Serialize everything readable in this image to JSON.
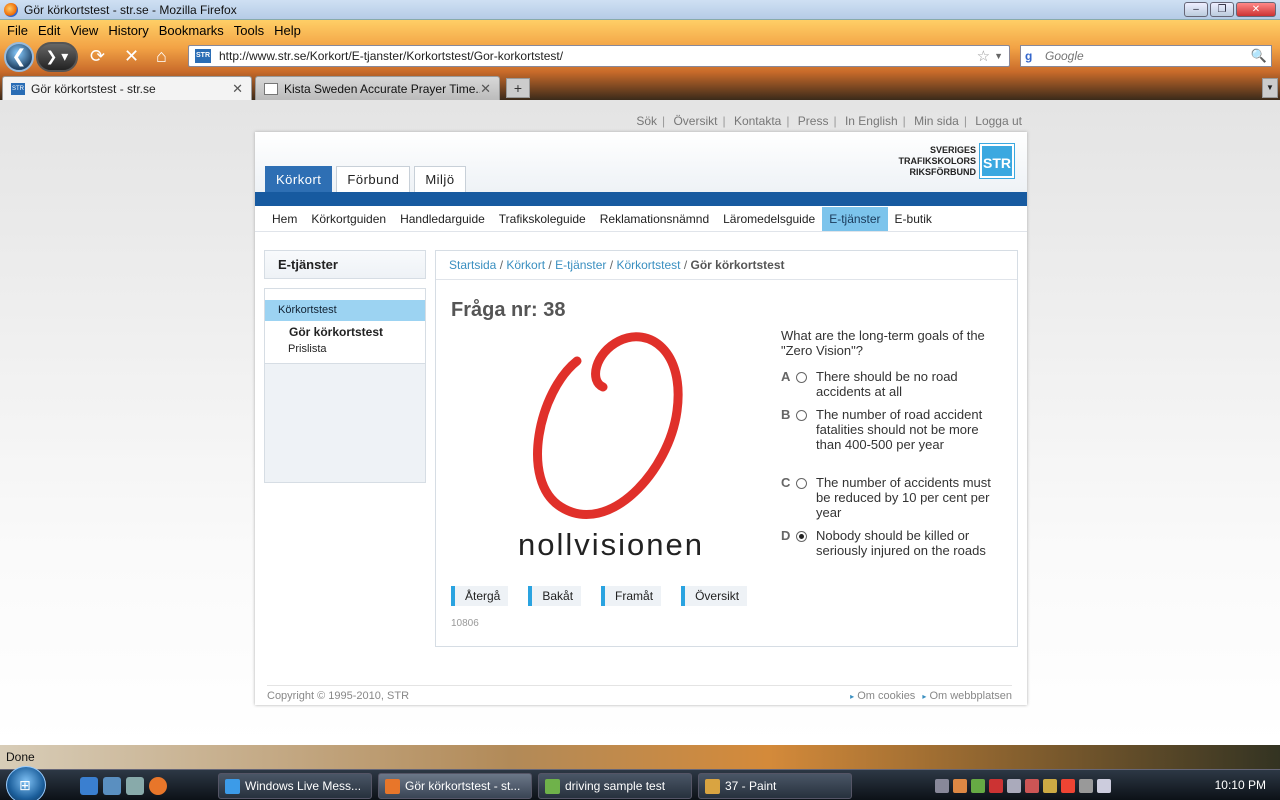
{
  "window": {
    "title": "Gör körkortstest - str.se - Mozilla Firefox"
  },
  "menu": [
    "File",
    "Edit",
    "View",
    "History",
    "Bookmarks",
    "Tools",
    "Help"
  ],
  "nav": {
    "url": "http://www.str.se/Korkort/E-tjanster/Korkortstest/Gor-korkortstest/",
    "search_placeholder": "Google"
  },
  "tabs": [
    {
      "label": "Gör körkortstest - str.se",
      "active": true
    },
    {
      "label": "Kista Sweden Accurate Prayer Time...",
      "active": false
    }
  ],
  "site": {
    "toplinks": [
      "Sök",
      "Översikt",
      "Kontakta",
      "Press",
      "In English",
      "Min sida",
      "Logga ut"
    ],
    "logo": {
      "line1": "SVERIGES",
      "line2": "TRAFIKSKOLORS",
      "line3": "RIKSFÖRBUND",
      "mark": "STR"
    },
    "main_tabs": [
      "Körkort",
      "Förbund",
      "Miljö"
    ],
    "subnav": [
      "Hem",
      "Körkortguiden",
      "Handledarguide",
      "Trafikskoleguide",
      "Reklamationsnämnd",
      "Läromedelsguide",
      "E-tjänster",
      "E-butik"
    ],
    "subnav_active": "E-tjänster",
    "sidebar": {
      "heading": "E-tjänster",
      "category": "Körkortstest",
      "current": "Gör körkortstest",
      "item": "Prislista"
    },
    "breadcrumb": [
      "Startsida",
      "Körkort",
      "E-tjänster",
      "Körkortstest"
    ],
    "breadcrumb_current": "Gör körkortstest",
    "question": {
      "number_label": "Fråga nr: 38",
      "text": "What are the long-term goals of the \"Zero Vision\"?",
      "image_text": "nollvisionen",
      "options": [
        {
          "letter": "A",
          "text": "There should be no road accidents at all",
          "selected": false
        },
        {
          "letter": "B",
          "text": "The number of road accident fatalities should not be more than 400-500 per year",
          "selected": false
        },
        {
          "letter": "C",
          "text": "The number of accidents must be reduced by 10 per cent per year",
          "selected": false
        },
        {
          "letter": "D",
          "text": "Nobody should be killed or seriously injured on the roads",
          "selected": true
        }
      ],
      "buttons": [
        "Återgå",
        "Bakåt",
        "Framåt",
        "Översikt"
      ],
      "id": "10806"
    },
    "footer": {
      "copyright": "Copyright © 1995-2010, STR",
      "links": [
        "Om cookies",
        "Om webbplatsen"
      ]
    }
  },
  "status": "Done",
  "taskbar": {
    "tasks": [
      {
        "label": "Windows Live Mess...",
        "icon_color": "#3c9be8"
      },
      {
        "label": "Gör körkortstest - st...",
        "icon_color": "#e8762a"
      },
      {
        "label": "driving sample test",
        "icon_color": "#6fb24a"
      },
      {
        "label": "37 - Paint",
        "icon_color": "#d9a441"
      }
    ],
    "clock": "10:10 PM"
  }
}
